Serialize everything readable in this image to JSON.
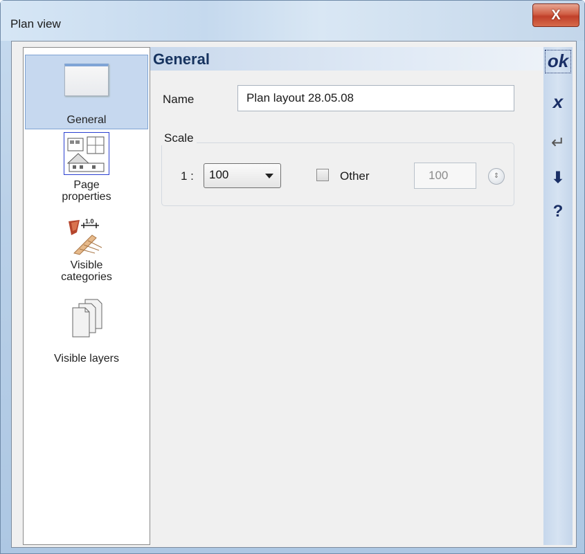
{
  "window": {
    "title": "Plan view",
    "close_label": "X"
  },
  "nav": {
    "items": [
      {
        "label": "General",
        "icon": "window-icon",
        "selected": true
      },
      {
        "label": "Page properties",
        "icon": "page-properties-icon",
        "selected": false
      },
      {
        "label": "Visible categories",
        "icon": "categories-icon",
        "selected": false
      },
      {
        "label": "Visible layers",
        "icon": "layers-icon",
        "selected": false
      }
    ]
  },
  "general": {
    "header": "General",
    "name_label": "Name",
    "name_value": "Plan layout 28.05.08",
    "scale_group": "Scale",
    "scale_prefix": "1 :",
    "scale_value": "100",
    "other_label": "Other",
    "other_checked": false,
    "other_value": "100"
  },
  "toolbar": {
    "ok": "ok",
    "cancel": "x",
    "apply": "↵",
    "save": "⬇",
    "help": "?"
  },
  "colors": {
    "accent": "#16335f",
    "selected_bg": "#c6d8ef",
    "close": "#c0402a"
  }
}
